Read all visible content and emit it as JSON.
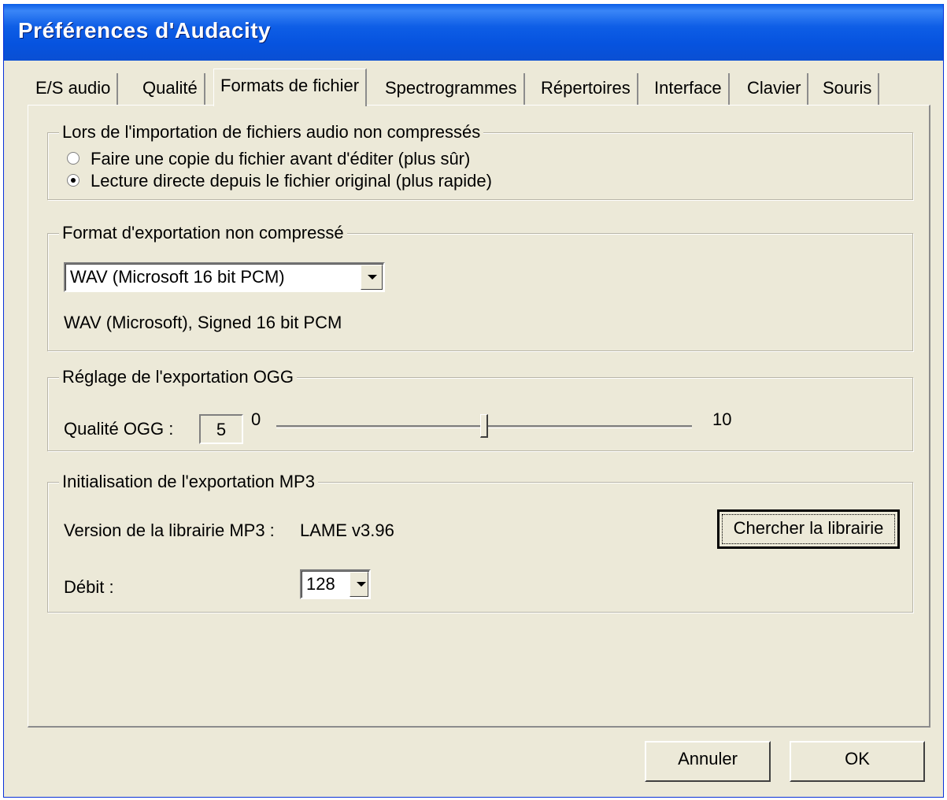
{
  "window": {
    "title": "Préférences d'Audacity"
  },
  "tabs": [
    {
      "label": "E/S audio"
    },
    {
      "label": "Qualité"
    },
    {
      "label": "Formats de fichier"
    },
    {
      "label": "Spectrogrammes"
    },
    {
      "label": "Répertoires"
    },
    {
      "label": "Interface"
    },
    {
      "label": "Clavier"
    },
    {
      "label": "Souris"
    }
  ],
  "active_tab": "Formats de fichier",
  "import_group": {
    "title": "Lors de l'importation de fichiers audio non compressés",
    "options": [
      {
        "label": "Faire une copie du fichier avant d'éditer (plus sûr)",
        "checked": false
      },
      {
        "label": "Lecture directe depuis le fichier original (plus rapide)",
        "checked": true
      }
    ]
  },
  "export_format_group": {
    "title": "Format d'exportation non compressé",
    "selected": "WAV (Microsoft 16 bit PCM)",
    "description": "WAV (Microsoft), Signed 16 bit PCM"
  },
  "ogg_group": {
    "title": "Réglage de l'exportation OGG",
    "quality_label": "Qualité OGG :",
    "quality_value": "5",
    "min_label": "0",
    "max_label": "10",
    "slider_value": 5,
    "slider_min": 0,
    "slider_max": 10
  },
  "mp3_group": {
    "title": "Initialisation de l'exportation MP3",
    "version_label": "Version de la librairie MP3 :",
    "version_value": "LAME v3.96",
    "find_button": "Chercher la librairie",
    "bitrate_label": "Débit :",
    "bitrate_value": "128"
  },
  "footer": {
    "cancel": "Annuler",
    "ok": "OK"
  }
}
